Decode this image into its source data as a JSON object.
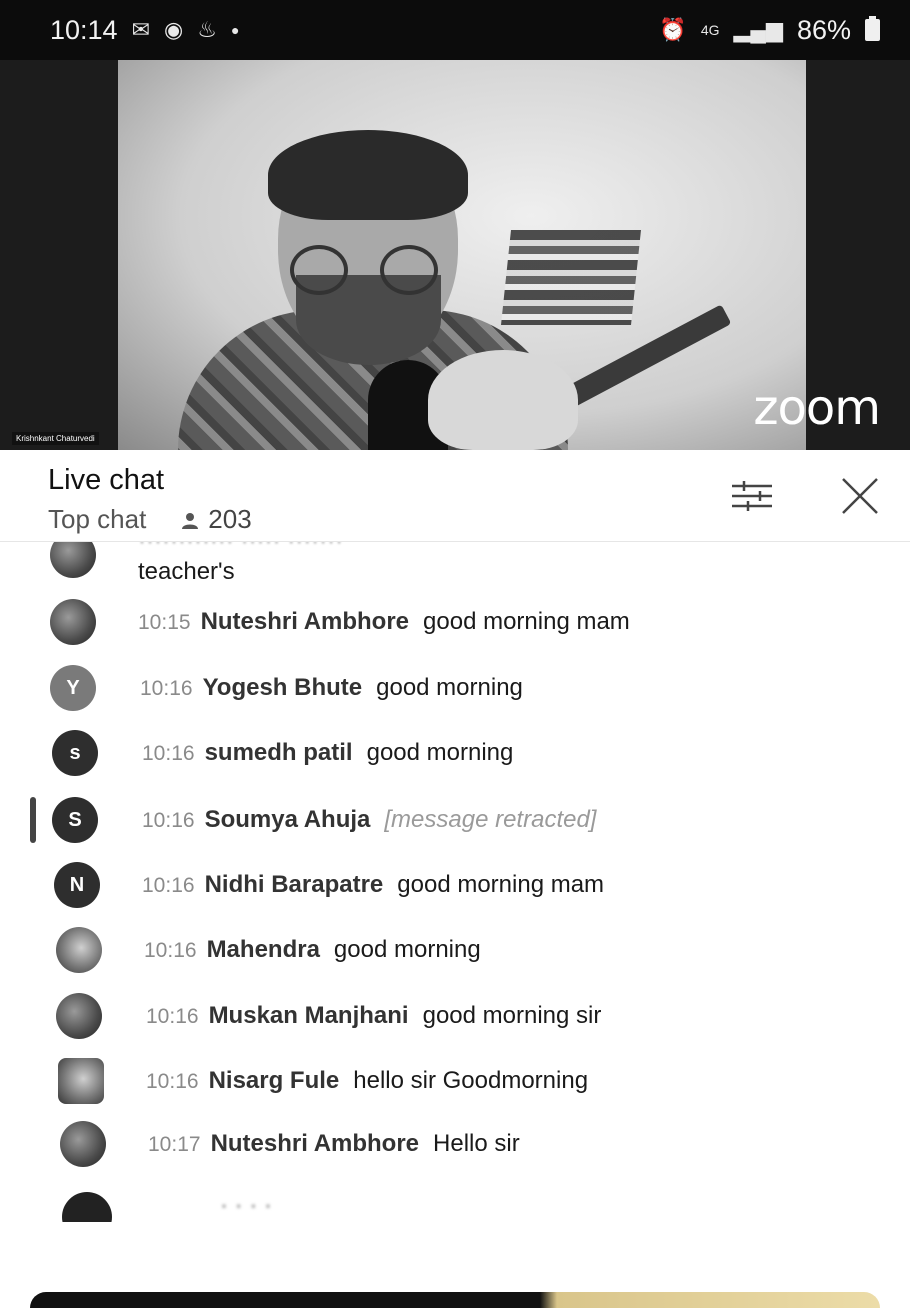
{
  "status_bar": {
    "time": "10:14",
    "battery": "86%",
    "network": "4G",
    "left_icons": [
      "gmail-icon",
      "messenger-icon",
      "notification-icon",
      "dot-icon"
    ],
    "right_icons": [
      "alarm-icon",
      "network-4g-icon",
      "signal-icon",
      "battery-icon"
    ]
  },
  "video": {
    "participant_name": "Krishnkant Chaturvedi",
    "logo": "zoom"
  },
  "chat": {
    "title": "Live chat",
    "mode": "Top chat",
    "viewer_count": "203",
    "cut_message_top": "teacher's",
    "messages": [
      {
        "time": "10:15",
        "author": "Nuteshri Ambhore",
        "text": "good morning mam",
        "avatar": ""
      },
      {
        "time": "10:16",
        "author": "Yogesh Bhute",
        "text": "good morning",
        "avatar": "Y"
      },
      {
        "time": "10:16",
        "author": "sumedh patil",
        "text": "good morning",
        "avatar": "s"
      },
      {
        "time": "10:16",
        "author": "Soumya Ahuja",
        "text": "[message retracted]",
        "avatar": "S"
      },
      {
        "time": "10:16",
        "author": "Nidhi Barapatre",
        "text": "good morning mam",
        "avatar": "N"
      },
      {
        "time": "10:16",
        "author": "Mahendra",
        "text": "good morning",
        "avatar": ""
      },
      {
        "time": "10:16",
        "author": "Muskan Manjhani",
        "text": "good morning sir",
        "avatar": ""
      },
      {
        "time": "10:16",
        "author": "Nisarg Fule",
        "text": "hello sir Goodmorning",
        "avatar": ""
      },
      {
        "time": "10:17",
        "author": "Nuteshri Ambhore",
        "text": "Hello sir",
        "avatar": ""
      }
    ]
  },
  "colors": {
    "status_bar_bg": "#0c0c0c",
    "timestamp": "#8a8a8a",
    "retracted": "#9a9a9a"
  }
}
